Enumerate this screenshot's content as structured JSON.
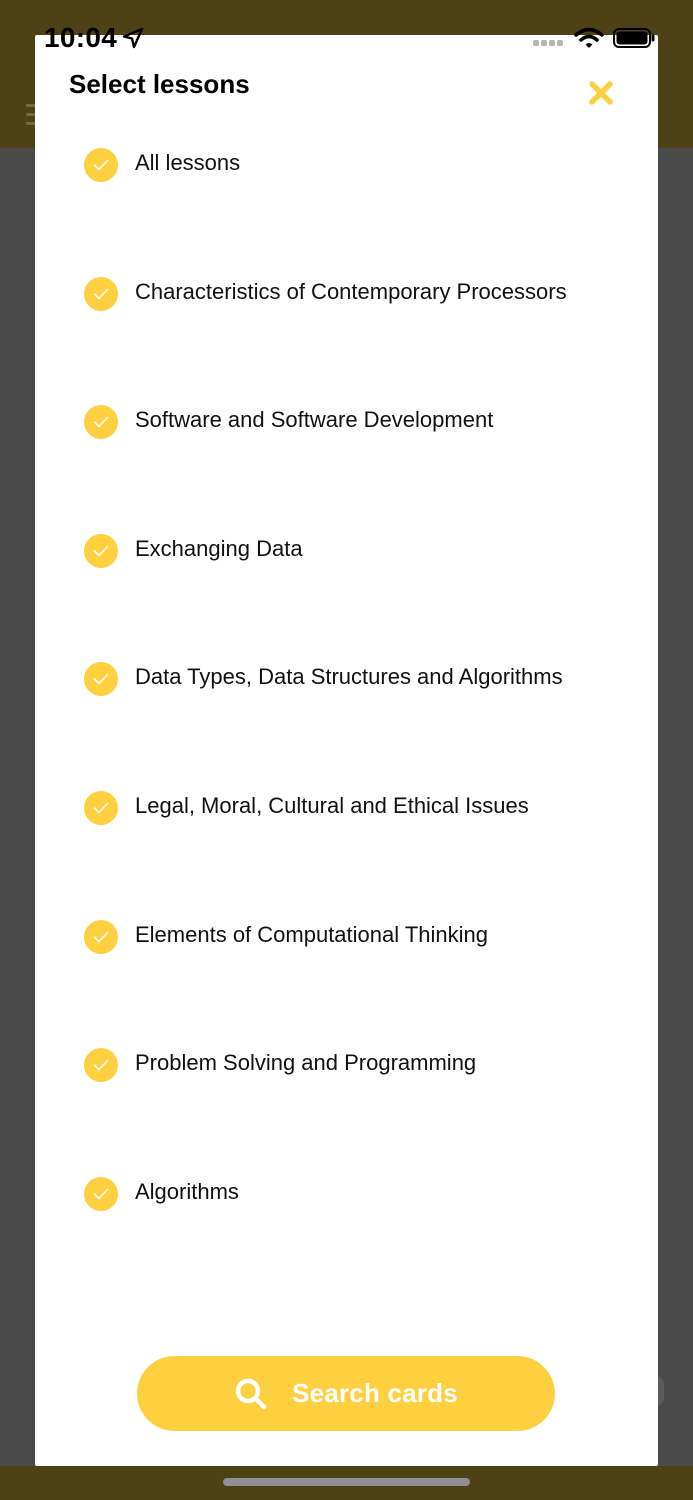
{
  "status_bar": {
    "time": "10:04",
    "icons": [
      "location-arrow-icon",
      "signal-icon",
      "wifi-icon",
      "battery-icon"
    ]
  },
  "modal": {
    "title": "Select lessons",
    "close_icon": "close-icon",
    "lessons": [
      {
        "label": "All lessons",
        "checked": true
      },
      {
        "label": "Characteristics of Contemporary Processors",
        "checked": true
      },
      {
        "label": "Software and Software Development",
        "checked": true
      },
      {
        "label": "Exchanging Data",
        "checked": true
      },
      {
        "label": "Data Types, Data Structures and Algorithms",
        "checked": true
      },
      {
        "label": "Legal, Moral, Cultural and Ethical Issues",
        "checked": true
      },
      {
        "label": "Elements of Computational Thinking",
        "checked": true
      },
      {
        "label": "Problem Solving and Programming",
        "checked": true
      },
      {
        "label": "Algorithms",
        "checked": true
      }
    ],
    "search_button": {
      "label": "Search cards",
      "icon": "search-icon"
    }
  },
  "colors": {
    "accent": "#fecf3f",
    "header_bg": "#4e4115",
    "overlay": "#4a4a4a",
    "modal_bg": "#ffffff"
  }
}
